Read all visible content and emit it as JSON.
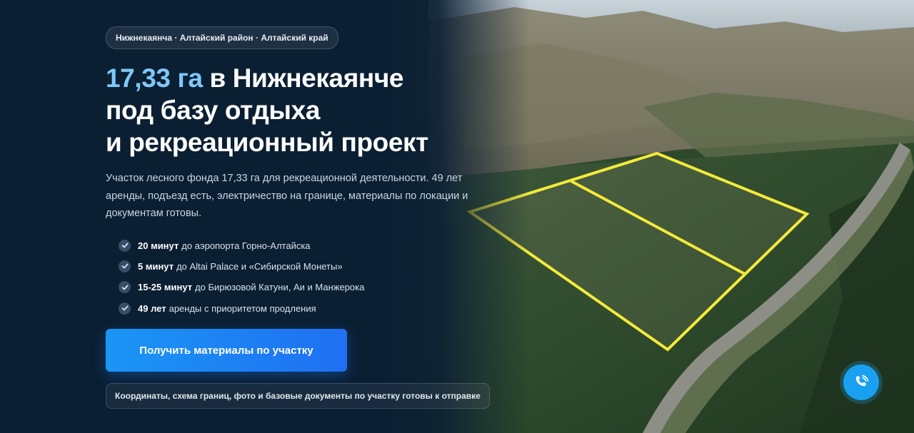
{
  "hero": {
    "location": "Нижнекаянча · Алтайский район · Алтайский край",
    "title": {
      "accent": "17,33 га",
      "line1_rest": " в Нижнекаянче",
      "line2": "под базу отдыха",
      "line3": "и рекреационный проект"
    },
    "description": "Участок лесного фонда 17,33 га для рекреационной деятельности. 49 лет аренды, подъезд есть, электричество на границе, материалы по локации и документам готовы.",
    "features": [
      {
        "bold": "20 минут",
        "text": "до аэропорта Горно-Алтайска"
      },
      {
        "bold": "5 минут",
        "text": "до Altai Palace и «Сибирской Монеты»"
      },
      {
        "bold": "15-25 минут",
        "text": "до Бирюзовой Катуни, Аи и Манжерока"
      },
      {
        "bold": "49 лет",
        "text": "аренды с приоритетом продления"
      }
    ],
    "cta_label": "Получить материалы по участку",
    "note": "Координаты, схема границ, фото и базовые документы по участку готовы к отправке"
  },
  "icons": {
    "feature": "check-icon",
    "call": "phone-icon"
  },
  "colors": {
    "accent": "#7fc8f8",
    "button": "#1a96f4",
    "plot_outline": "#f4ea3a",
    "call_button": "#1aa0f0"
  }
}
